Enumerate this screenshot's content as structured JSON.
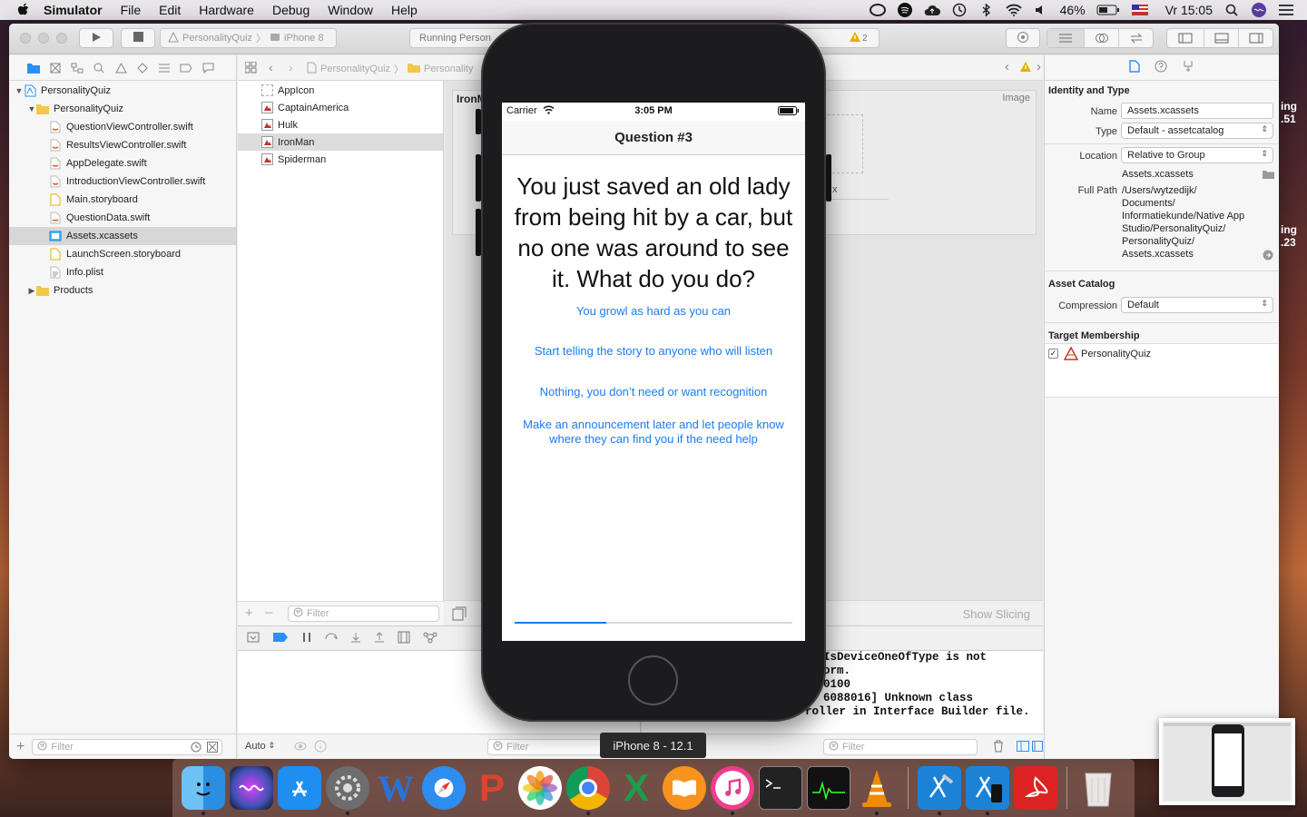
{
  "menubar": {
    "app": "Simulator",
    "items": [
      "File",
      "Edit",
      "Hardware",
      "Debug",
      "Window",
      "Help"
    ],
    "battery": "46%",
    "clock": "Vr 15:05"
  },
  "toolbar": {
    "scheme_project": "PersonalityQuiz",
    "scheme_device": "iPhone 8",
    "status_text": "Running Person",
    "warning_count": "2"
  },
  "navigator": {
    "rows": [
      {
        "label": "PersonalityQuiz",
        "kind": "project",
        "indent": 0,
        "disclosure": "open"
      },
      {
        "label": "PersonalityQuiz",
        "kind": "folder",
        "indent": 1,
        "disclosure": "open"
      },
      {
        "label": "QuestionViewController.swift",
        "kind": "swift",
        "indent": 2
      },
      {
        "label": "ResultsViewController.swift",
        "kind": "swift",
        "indent": 2
      },
      {
        "label": "AppDelegate.swift",
        "kind": "swift",
        "indent": 2
      },
      {
        "label": "IntroductionViewController.swift",
        "kind": "swift",
        "indent": 2
      },
      {
        "label": "Main.storyboard",
        "kind": "storyboard",
        "indent": 2
      },
      {
        "label": "QuestionData.swift",
        "kind": "swift",
        "indent": 2
      },
      {
        "label": "Assets.xcassets",
        "kind": "assets",
        "indent": 2,
        "selected": true
      },
      {
        "label": "LaunchScreen.storyboard",
        "kind": "storyboard",
        "indent": 2
      },
      {
        "label": "Info.plist",
        "kind": "plist",
        "indent": 2
      },
      {
        "label": "Products",
        "kind": "folder",
        "indent": 1,
        "disclosure": "closed"
      }
    ],
    "filter_placeholder": "Filter"
  },
  "jumpbar": {
    "crumb1": "PersonalityQuiz",
    "crumb2": "Personality"
  },
  "assets": {
    "items": [
      {
        "label": "AppIcon",
        "selected": false
      },
      {
        "label": "CaptainAmerica",
        "selected": false
      },
      {
        "label": "Hulk",
        "selected": false
      },
      {
        "label": "IronMan",
        "selected": true
      },
      {
        "label": "Spiderman",
        "selected": false
      }
    ],
    "filter_placeholder": "Filter"
  },
  "editor": {
    "imageset_title": "IronM",
    "image_label": "Image",
    "slot_label": "x",
    "show_slicing": "Show Slicing"
  },
  "debug": {
    "auto_label": "Auto",
    "vars_filter": "Filter",
    "console_filter": "Filter",
    "console_lines": [
      "IsDeviceOneOfType is not",
      "orm.",
      "0100",
      "6088016] Unknown class",
      "roller in Interface Builder file."
    ]
  },
  "inspector": {
    "identity_title": "Identity and Type",
    "name_label": "Name",
    "name_value": "Assets.xcassets",
    "type_label": "Type",
    "type_value": "Default - assetcatalog",
    "location_label": "Location",
    "location_value": "Relative to Group",
    "location_file": "Assets.xcassets",
    "fullpath_label": "Full Path",
    "fullpath_lines": [
      "/Users/wytzedijk/",
      "Documents/",
      "Informatiekunde/Native App",
      "Studio/PersonalityQuiz/",
      "PersonalityQuiz/",
      "Assets.xcassets"
    ],
    "catalog_title": "Asset Catalog",
    "compression_label": "Compression",
    "compression_value": "Default",
    "membership_title": "Target Membership",
    "target_name": "PersonalityQuiz"
  },
  "simulator": {
    "carrier": "Carrier",
    "time": "3:05 PM",
    "nav_title": "Question #3",
    "question": "You just saved an old lady from being hit by a car, but no one was around to see it. What do you do?",
    "answers": [
      "You growl as hard as you can",
      "Start telling the story to anyone who will listen",
      "Nothing, you don’t need or want recognition",
      "Make an announcement later and let people know where they can find you if the need help"
    ],
    "progress": 0.33,
    "device_label": "iPhone 8 - 12.1"
  },
  "side_text": {
    "top1": "ing",
    "top2": ".51",
    "mid1": "ing",
    "mid2": ".23"
  },
  "dock": {
    "apps": [
      "finder-icon",
      "siri-icon",
      "app-store-icon",
      "system-preferences-icon",
      "word-icon",
      "safari-icon",
      "powerpoint-icon",
      "photos-icon",
      "chrome-icon",
      "excel-icon",
      "ibooks-icon",
      "itunes-icon",
      "terminal-icon",
      "activity-monitor-icon",
      "vlc-icon",
      "xcode-icon",
      "simulator-icon",
      "acrobat-icon",
      "trash-icon"
    ]
  },
  "colors": {
    "accent": "#1a7cf0",
    "selection": "#d7d7d7",
    "phone_body": "#1c1c1e"
  }
}
